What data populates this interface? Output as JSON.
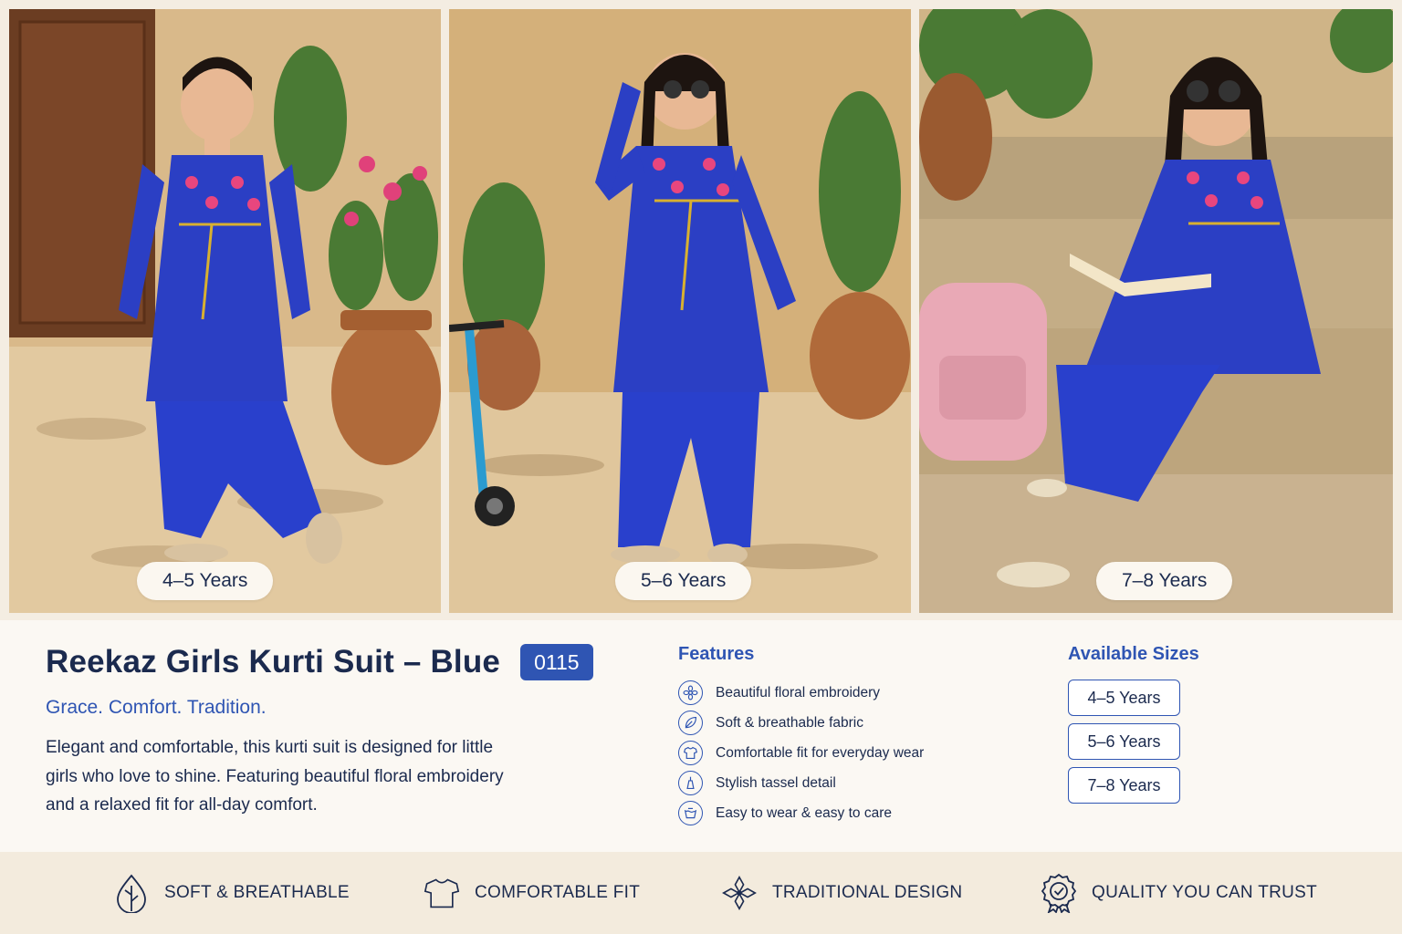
{
  "photos": [
    {
      "age_label": "4–5 Years"
    },
    {
      "age_label": "5–6 Years"
    },
    {
      "age_label": "7–8 Years"
    }
  ],
  "product": {
    "title": "Reekaz Girls Kurti Suit – Blue",
    "code": "0115",
    "tagline": "Grace. Comfort. Tradition.",
    "description": "Elegant and comfortable, this kurti suit is designed for little girls who love to shine. Featuring beautiful floral embroidery and a relaxed fit for all-day comfort."
  },
  "features": {
    "heading": "Features",
    "items": [
      {
        "icon": "flower-icon",
        "label": "Beautiful floral embroidery"
      },
      {
        "icon": "leaf-icon",
        "label": "Soft & breathable fabric"
      },
      {
        "icon": "tshirt-icon",
        "label": "Comfortable fit for everyday wear"
      },
      {
        "icon": "tassel-icon",
        "label": "Stylish tassel detail"
      },
      {
        "icon": "washing-icon",
        "label": "Easy to wear & easy to care"
      }
    ]
  },
  "sizes": {
    "heading": "Available Sizes",
    "options": [
      "4–5 Years",
      "5–6 Years",
      "7–8 Years"
    ]
  },
  "benefits": [
    {
      "icon": "leaf-drop-icon",
      "label": "SOFT & BREATHABLE"
    },
    {
      "icon": "tshirt-icon",
      "label": "COMFORTABLE FIT"
    },
    {
      "icon": "ornament-icon",
      "label": "TRADITIONAL DESIGN"
    },
    {
      "icon": "quality-badge-icon",
      "label": "QUALITY YOU CAN TRUST"
    }
  ],
  "colors": {
    "accent": "#2f55b3",
    "navy": "#1b2a4e",
    "kurti_blue": "#2b3fc4",
    "background": "#fbf8f3",
    "bottom_bar": "#f3ebdd"
  }
}
